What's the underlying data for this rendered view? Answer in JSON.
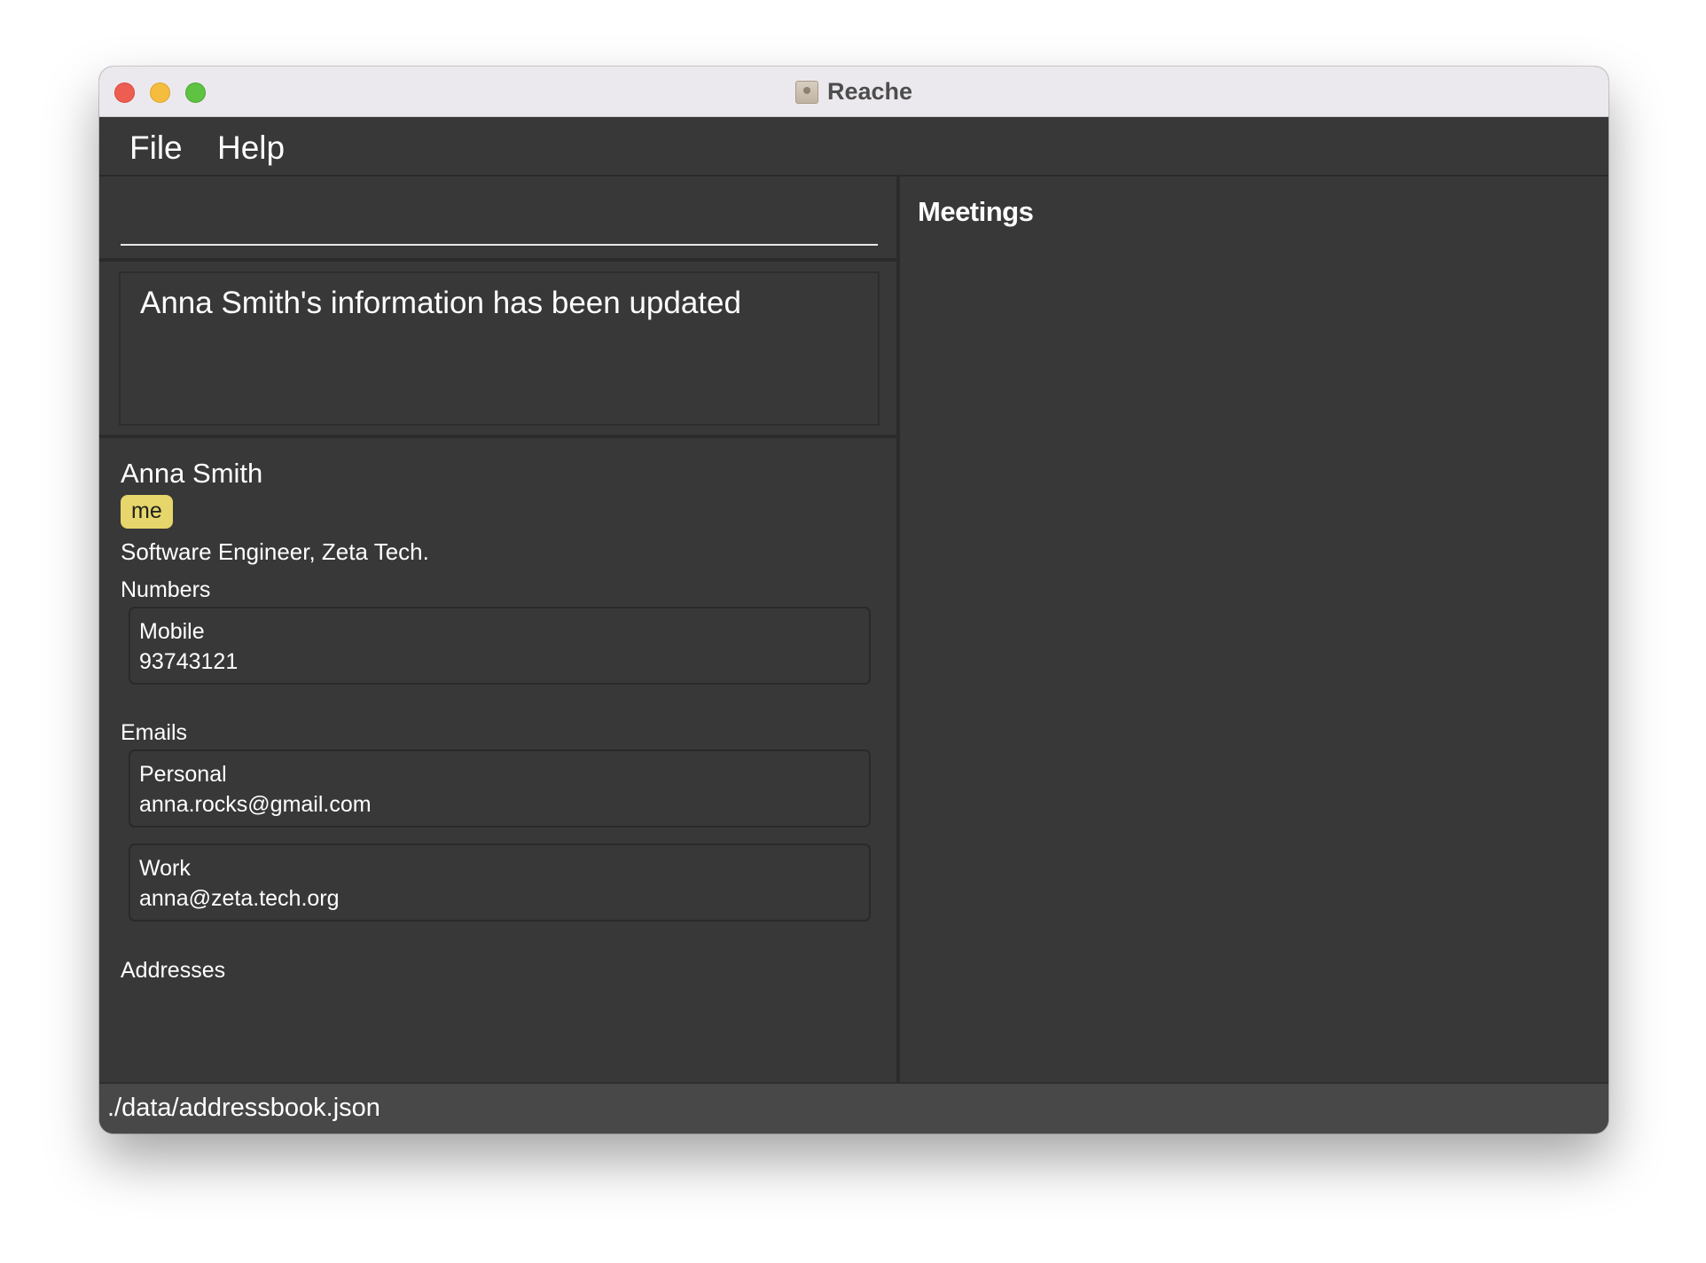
{
  "window": {
    "title": "Reache"
  },
  "menu": {
    "file": "File",
    "help": "Help"
  },
  "command": {
    "value": "",
    "placeholder": ""
  },
  "result": {
    "message": "Anna Smith's information has been updated"
  },
  "person": {
    "name": "Anna Smith",
    "tags": [
      "me"
    ],
    "title": "Software Engineer, Zeta Tech.",
    "numbers_label": "Numbers",
    "numbers": [
      {
        "label": "Mobile",
        "value": "93743121"
      }
    ],
    "emails_label": "Emails",
    "emails": [
      {
        "label": "Personal",
        "value": "anna.rocks@gmail.com"
      },
      {
        "label": "Work",
        "value": "anna@zeta.tech.org"
      }
    ],
    "addresses_label": "Addresses",
    "addresses": []
  },
  "meetings": {
    "title": "Meetings",
    "items": []
  },
  "status": {
    "path": "./data/addressbook.json"
  },
  "colors": {
    "background": "#383838",
    "tag": "#e6d66b",
    "close": "#ee5d52",
    "minimize": "#f5bd3d",
    "maximize": "#5ec242"
  }
}
